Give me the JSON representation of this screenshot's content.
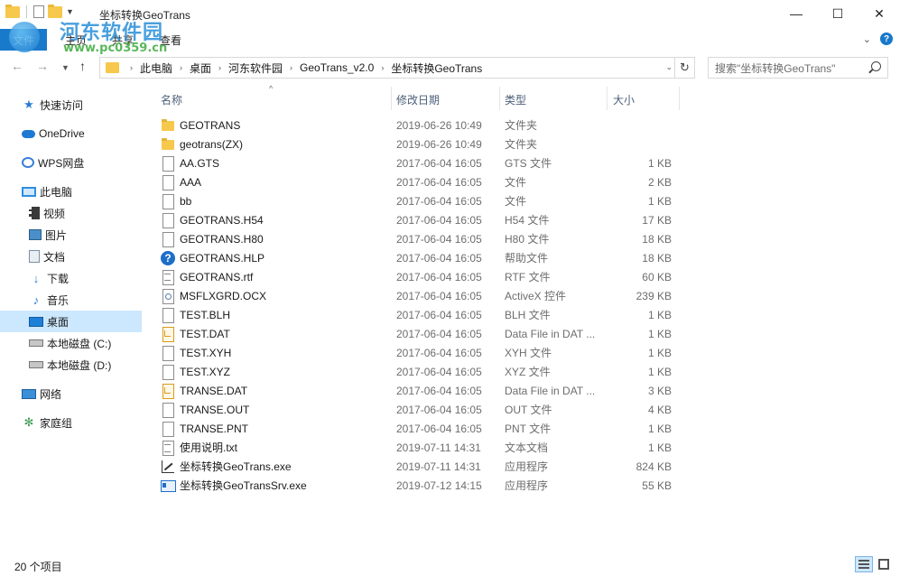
{
  "window": {
    "title": "坐标转换GeoTrans",
    "controls": {
      "minimize": "—",
      "maximize": "☐",
      "close": "✕"
    }
  },
  "watermark": {
    "name": "河东软件园",
    "url": "www.pc0359.cn"
  },
  "ribbon": {
    "tabs": [
      "文件",
      "主页",
      "共享",
      "查看"
    ]
  },
  "address": {
    "crumbs": [
      "此电脑",
      "桌面",
      "河东软件园",
      "GeoTrans_v2.0",
      "坐标转换GeoTrans"
    ]
  },
  "search": {
    "placeholder": "搜索\"坐标转换GeoTrans\""
  },
  "nav": {
    "items": [
      {
        "label": "快速访问",
        "icon": "star-icon",
        "level": 0
      },
      {
        "label": "OneDrive",
        "icon": "cloud-icon",
        "level": 0
      },
      {
        "label": "WPS网盘",
        "icon": "wps-icon",
        "level": 0
      },
      {
        "label": "此电脑",
        "icon": "computer-icon",
        "level": 0
      },
      {
        "label": "视频",
        "icon": "video-icon",
        "level": 1
      },
      {
        "label": "图片",
        "icon": "pictures-icon",
        "level": 1
      },
      {
        "label": "文档",
        "icon": "documents-icon",
        "level": 1
      },
      {
        "label": "下载",
        "icon": "download-icon",
        "level": 1
      },
      {
        "label": "音乐",
        "icon": "music-icon",
        "level": 1
      },
      {
        "label": "桌面",
        "icon": "desktop-icon",
        "level": 1,
        "selected": true
      },
      {
        "label": "本地磁盘 (C:)",
        "icon": "drive-icon",
        "level": 1
      },
      {
        "label": "本地磁盘 (D:)",
        "icon": "drive-icon",
        "level": 1
      },
      {
        "label": "网络",
        "icon": "network-icon",
        "level": 0
      },
      {
        "label": "家庭组",
        "icon": "homegroup-icon",
        "level": 0
      }
    ]
  },
  "columns": {
    "name": "名称",
    "date": "修改日期",
    "type": "类型",
    "size": "大小"
  },
  "files": [
    {
      "name": "GEOTRANS",
      "date": "2019-06-26 10:49",
      "type": "文件夹",
      "size": "",
      "icon": "folder"
    },
    {
      "name": "geotrans(ZX)",
      "date": "2019-06-26 10:49",
      "type": "文件夹",
      "size": "",
      "icon": "folder"
    },
    {
      "name": "AA.GTS",
      "date": "2017-06-04 16:05",
      "type": "GTS 文件",
      "size": "1 KB",
      "icon": "file"
    },
    {
      "name": "AAA",
      "date": "2017-06-04 16:05",
      "type": "文件",
      "size": "2 KB",
      "icon": "file"
    },
    {
      "name": "bb",
      "date": "2017-06-04 16:05",
      "type": "文件",
      "size": "1 KB",
      "icon": "file"
    },
    {
      "name": "GEOTRANS.H54",
      "date": "2017-06-04 16:05",
      "type": "H54 文件",
      "size": "17 KB",
      "icon": "file"
    },
    {
      "name": "GEOTRANS.H80",
      "date": "2017-06-04 16:05",
      "type": "H80 文件",
      "size": "18 KB",
      "icon": "file"
    },
    {
      "name": "GEOTRANS.HLP",
      "date": "2017-06-04 16:05",
      "type": "帮助文件",
      "size": "18 KB",
      "icon": "help"
    },
    {
      "name": "GEOTRANS.rtf",
      "date": "2017-06-04 16:05",
      "type": "RTF 文件",
      "size": "60 KB",
      "icon": "rtf"
    },
    {
      "name": "MSFLXGRD.OCX",
      "date": "2017-06-04 16:05",
      "type": "ActiveX 控件",
      "size": "239 KB",
      "icon": "ocx"
    },
    {
      "name": "TEST.BLH",
      "date": "2017-06-04 16:05",
      "type": "BLH 文件",
      "size": "1 KB",
      "icon": "file"
    },
    {
      "name": "TEST.DAT",
      "date": "2017-06-04 16:05",
      "type": "Data File in DAT ...",
      "size": "1 KB",
      "icon": "dat"
    },
    {
      "name": "TEST.XYH",
      "date": "2017-06-04 16:05",
      "type": "XYH 文件",
      "size": "1 KB",
      "icon": "file"
    },
    {
      "name": "TEST.XYZ",
      "date": "2017-06-04 16:05",
      "type": "XYZ 文件",
      "size": "1 KB",
      "icon": "file"
    },
    {
      "name": "TRANSE.DAT",
      "date": "2017-06-04 16:05",
      "type": "Data File in DAT ...",
      "size": "3 KB",
      "icon": "dat"
    },
    {
      "name": "TRANSE.OUT",
      "date": "2017-06-04 16:05",
      "type": "OUT 文件",
      "size": "4 KB",
      "icon": "file"
    },
    {
      "name": "TRANSE.PNT",
      "date": "2017-06-04 16:05",
      "type": "PNT 文件",
      "size": "1 KB",
      "icon": "file"
    },
    {
      "name": "使用说明.txt",
      "date": "2019-07-11 14:31",
      "type": "文本文档",
      "size": "1 KB",
      "icon": "txt"
    },
    {
      "name": "坐标转换GeoTrans.exe",
      "date": "2019-07-11 14:31",
      "type": "应用程序",
      "size": "824 KB",
      "icon": "exe-app"
    },
    {
      "name": "坐标转换GeoTransSrv.exe",
      "date": "2019-07-12 14:15",
      "type": "应用程序",
      "size": "55 KB",
      "icon": "exe-srv"
    }
  ],
  "status": {
    "count": "20 个项目"
  }
}
